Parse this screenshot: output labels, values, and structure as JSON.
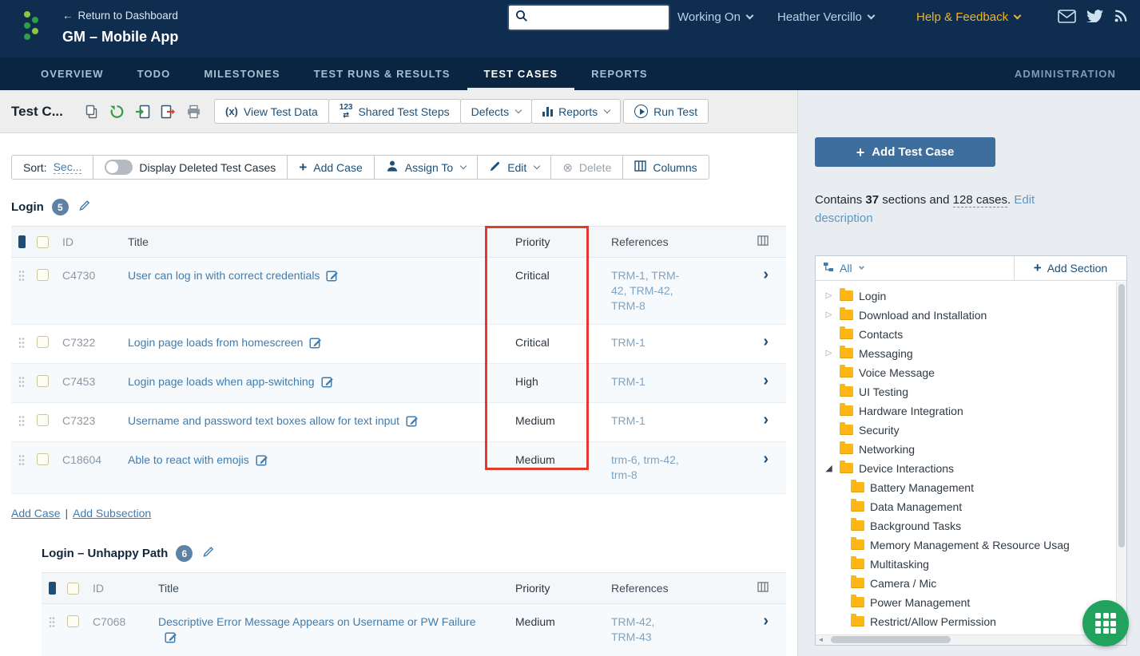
{
  "colors": {
    "header_navy": "#0e2d4f",
    "nav_navy": "#0a2541",
    "accent_blue": "#1d5078",
    "link_blue": "#3e7cb0",
    "reference_blue": "#7da3c4",
    "help_yellow": "#f0b429",
    "folder_yellow": "#fcb714",
    "highlight_red": "#e23b2d",
    "fab_green": "#22a35d",
    "badge_blue": "#5e82a3",
    "primary_button_blue": "#3e6e9d"
  },
  "glyphs": {
    "back_arrow": "←",
    "chevron_right": "›",
    "tree_collapsed": "▷",
    "tree_expanded": "◢",
    "plus": "+",
    "delete_circle": "⊗",
    "fx": "(x)",
    "steps_digits": "123",
    "steps_arrows": "⇄",
    "pipe": "|",
    "scroll_left": "◄",
    "scroll_right": "►"
  },
  "header": {
    "return_link": "Return to Dashboard",
    "project_title": "GM – Mobile App",
    "search_value": "",
    "working_on": "Working On",
    "user_name": "Heather Vercillo",
    "help_feedback": "Help & Feedback"
  },
  "nav": {
    "tabs": [
      {
        "label": "OVERVIEW"
      },
      {
        "label": "TODO"
      },
      {
        "label": "MILESTONES"
      },
      {
        "label": "TEST RUNS & RESULTS"
      },
      {
        "label": "TEST CASES"
      },
      {
        "label": "REPORTS"
      }
    ],
    "admin": "ADMINISTRATION"
  },
  "toolbar": {
    "page_title": "Test C...",
    "view_test_data": "View Test Data",
    "shared_test_steps": "Shared Test Steps",
    "defects": "Defects",
    "reports": "Reports",
    "run_test": "Run Test"
  },
  "actions": {
    "sort_label": "Sort:",
    "sort_value": "Sec...",
    "display_deleted": "Display Deleted Test Cases",
    "add_case": "Add Case",
    "assign_to": "Assign To",
    "edit": "Edit",
    "delete": "Delete",
    "columns": "Columns"
  },
  "table_columns": {
    "id": "ID",
    "title": "Title",
    "priority": "Priority",
    "references": "References"
  },
  "sections": [
    {
      "title": "Login",
      "count": "5",
      "rows": [
        {
          "id": "C4730",
          "title": "User can log in with correct credentials",
          "priority": "Critical",
          "references": "TRM-1, TRM-42, TRM-42, TRM-8"
        },
        {
          "id": "C7322",
          "title": "Login page loads from homescreen",
          "priority": "Critical",
          "references": "TRM-1"
        },
        {
          "id": "C7453",
          "title": "Login page loads when app-switching",
          "priority": "High",
          "references": "TRM-1"
        },
        {
          "id": "C7323",
          "title": "Username and password text boxes allow for text input",
          "priority": "Medium",
          "references": "TRM-1"
        },
        {
          "id": "C18604",
          "title": "Able to react with emojis",
          "priority": "Medium",
          "references": "trm-6, trm-42, trm-8"
        }
      ]
    },
    {
      "title": "Login – Unhappy Path",
      "count": "6",
      "rows": [
        {
          "id": "C7068",
          "title": "Descriptive Error Message Appears on Username or PW Failure",
          "priority": "Medium",
          "references": "TRM-42, TRM-43"
        }
      ]
    }
  ],
  "footer_links": {
    "add_case": "Add Case",
    "add_subsection": "Add Subsection"
  },
  "sidebar": {
    "add_test_case": "Add Test Case",
    "summary": {
      "prefix": "Contains",
      "sections_count": "37",
      "middle": "sections and",
      "cases_link": "128 cases",
      "period": ".",
      "edit_link": "Edit description"
    },
    "tree_filter": "All",
    "add_section": "Add Section",
    "tree": [
      {
        "label": "Login"
      },
      {
        "label": "Download and Installation"
      },
      {
        "label": "Contacts"
      },
      {
        "label": "Messaging"
      },
      {
        "label": "Voice Message"
      },
      {
        "label": "UI Testing"
      },
      {
        "label": "Hardware Integration"
      },
      {
        "label": "Security"
      },
      {
        "label": "Networking"
      },
      {
        "label": "Device Interactions"
      },
      {
        "label": "Battery Management"
      },
      {
        "label": "Data Management"
      },
      {
        "label": "Background Tasks"
      },
      {
        "label": "Memory Management & Resource Usag"
      },
      {
        "label": "Multitasking"
      },
      {
        "label": "Camera / Mic"
      },
      {
        "label": "Power Management"
      },
      {
        "label": "Restrict/Allow Permission"
      }
    ]
  }
}
